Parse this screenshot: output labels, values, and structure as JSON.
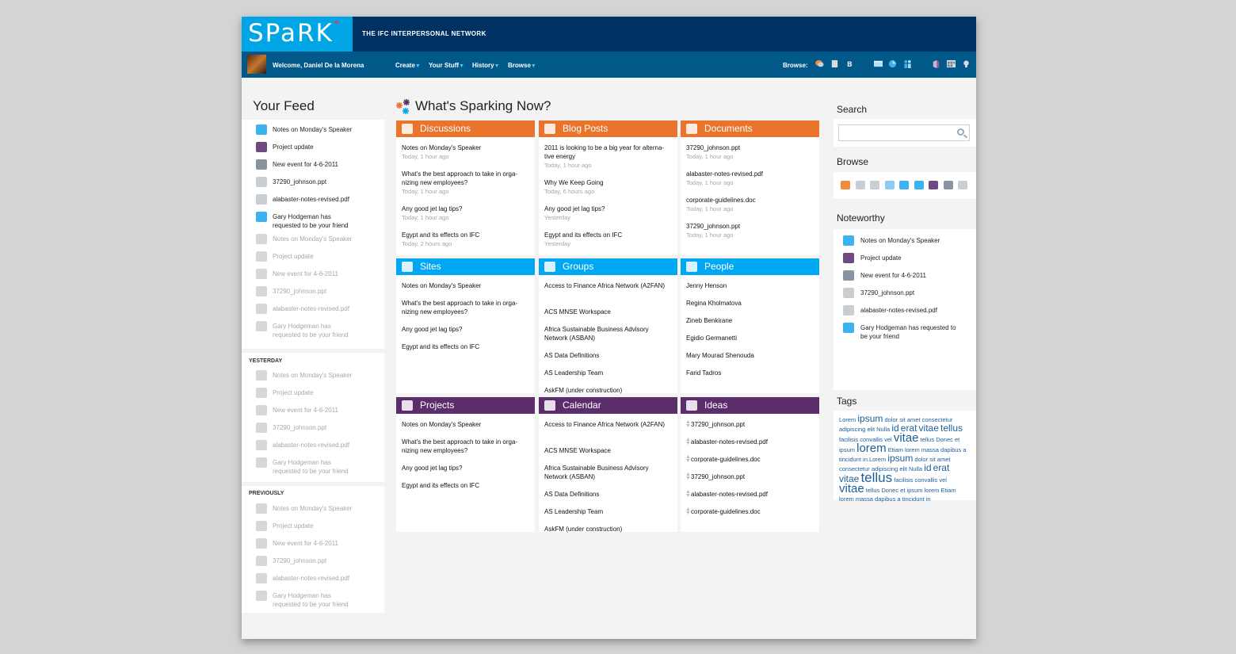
{
  "header": {
    "logo_text": "SPaRK",
    "tagline": "THE IFC INTERPERSONAL NETWORK"
  },
  "nav": {
    "welcome": "Welcome, Daniel De la Morena",
    "menus": [
      "Create",
      "Your Stuff",
      "History",
      "Browse"
    ],
    "browse_label": "Browse:",
    "browse_icons": [
      "discussion-icon",
      "document-icon",
      "blog-icon",
      "sites-icon",
      "groups-icon",
      "people-icon",
      "projects-icon",
      "calendar-icon",
      "ideas-icon"
    ]
  },
  "feed": {
    "title": "Your Feed",
    "today": [
      {
        "icon": "groups-icon",
        "text": "Notes on Monday's Speaker"
      },
      {
        "icon": "projects-icon",
        "text": "Project update"
      },
      {
        "icon": "calendar-icon",
        "text": "New event for 4-6-2011"
      },
      {
        "icon": "document-icon",
        "text": "37290_johnson.ppt"
      },
      {
        "icon": "document-icon",
        "text": "alabaster-notes-revised.pdf"
      },
      {
        "icon": "people-icon",
        "text": "Gary Hodgeman has requested to be your friend"
      },
      {
        "icon": "groups-icon",
        "text": "Notes on Monday's Speaker"
      },
      {
        "icon": "projects-icon",
        "text": "Project update"
      },
      {
        "icon": "calendar-icon",
        "text": "New event for 4-6-2011"
      },
      {
        "icon": "document-icon",
        "text": "37290_johnson.ppt"
      },
      {
        "icon": "document-icon",
        "text": "alabaster-notes-revised.pdf"
      },
      {
        "icon": "people-icon",
        "text": "Gary Hodgeman has requested to be your friend"
      }
    ],
    "yesterday_label": "YESTERDAY",
    "yesterday": [
      {
        "icon": "groups-icon",
        "text": "Notes on Monday's Speaker"
      },
      {
        "icon": "projects-icon",
        "text": "Project update"
      },
      {
        "icon": "calendar-icon",
        "text": "New event for 4-6-2011"
      },
      {
        "icon": "document-icon",
        "text": "37290_johnson.ppt"
      },
      {
        "icon": "document-icon",
        "text": "alabaster-notes-revised.pdf"
      },
      {
        "icon": "people-icon",
        "text": "Gary Hodgeman has requested to be your friend"
      }
    ],
    "previously_label": "PREVIOUSLY",
    "previously": [
      {
        "icon": "groups-icon",
        "text": "Notes on Monday's Speaker"
      },
      {
        "icon": "projects-icon",
        "text": "Project update"
      },
      {
        "icon": "calendar-icon",
        "text": "New event for 4-6-2011"
      },
      {
        "icon": "document-icon",
        "text": "37290_johnson.ppt"
      },
      {
        "icon": "document-icon",
        "text": "alabaster-notes-revised.pdf"
      },
      {
        "icon": "people-icon",
        "text": "Gary Hodgeman has requested to be your friend"
      }
    ]
  },
  "sparking": {
    "title": "What's Sparking Now?",
    "boxes": [
      {
        "title": "Discussions",
        "color": "orange",
        "icon": "discussion-icon",
        "items": [
          {
            "text": "Notes on Monday's Speaker",
            "meta": "Today, 1 hour ago"
          },
          {
            "text": "What's the best approach to take in orga-nizing new employees?",
            "meta": "Today, 1 hour ago"
          },
          {
            "text": "Any good jet lag tips?",
            "meta": "Today, 1 hour ago"
          },
          {
            "text": "Egypt and its effects on IFC",
            "meta": "Today, 2 hours ago"
          }
        ]
      },
      {
        "title": "Blog Posts",
        "color": "orange",
        "icon": "blog-icon",
        "items": [
          {
            "text": "2011 is looking to be a big year for alterna-tive energy",
            "meta": "Today, 1 hour ago"
          },
          {
            "text": "Why We Keep Going",
            "meta": "Today, 6 hours ago"
          },
          {
            "text": "Any good jet lag tips?",
            "meta": "Yesterday"
          },
          {
            "text": "Egypt and its effects on IFC",
            "meta": "Yesterday"
          }
        ]
      },
      {
        "title": "Documents",
        "color": "orange",
        "icon": "document-icon",
        "items": [
          {
            "text": "37290_johnson.ppt",
            "meta": "Today, 1 hour ago"
          },
          {
            "text": "alabaster-notes-revised.pdf",
            "meta": "Today, 1 hour ago"
          },
          {
            "text": "corporate-guidelines.doc",
            "meta": "Today, 1 hour ago"
          },
          {
            "text": "37290_johnson.ppt",
            "meta": "Today, 1 hour ago"
          }
        ]
      },
      {
        "title": "Sites",
        "color": "blue",
        "icon": "sites-icon",
        "items": [
          {
            "text": "Notes on Monday's Speaker"
          },
          {
            "text": "What's the best approach to take in orga-nizing new employees?"
          },
          {
            "text": "Any good jet lag tips?"
          },
          {
            "text": "Egypt and its effects on IFC"
          }
        ]
      },
      {
        "title": "Groups",
        "color": "blue",
        "icon": "groups-icon",
        "items": [
          {
            "text": "Access to Finance Africa Network (A2FAN)"
          },
          {
            "text": "ACS MNSE Workspace"
          },
          {
            "text": "Africa Sustainable Business Advisory Network (ASBAN)"
          },
          {
            "text": "AS Data Definitions"
          },
          {
            "text": "AS Leadership Team"
          },
          {
            "text": "AskFM (under construction)"
          }
        ]
      },
      {
        "title": "People",
        "color": "blue",
        "icon": "people-icon",
        "items": [
          {
            "text": "Jenny Henson"
          },
          {
            "text": "Regina Kholmatova"
          },
          {
            "text": "Zineb Benkirane"
          },
          {
            "text": "Egidio Germanetti"
          },
          {
            "text": "Mary Mourad Shenouda"
          },
          {
            "text": "Farid Tadros"
          }
        ]
      },
      {
        "title": "Projects",
        "color": "purple",
        "icon": "projects-icon",
        "items": [
          {
            "text": "Notes on Monday's Speaker"
          },
          {
            "text": "What's the best approach to take in orga-nizing new employees?"
          },
          {
            "text": "Any good jet lag tips?"
          },
          {
            "text": "Egypt and its effects on IFC"
          }
        ]
      },
      {
        "title": "Calendar",
        "color": "purple",
        "icon": "calendar-icon",
        "items": [
          {
            "text": "Access to Finance Africa Network (A2FAN)"
          },
          {
            "text": "ACS MNSE Workspace"
          },
          {
            "text": "Africa Sustainable Business Advisory Network (ASBAN)"
          },
          {
            "text": "AS Data Definitions"
          },
          {
            "text": "AS Leadership Team"
          },
          {
            "text": "AskFM (under construction)"
          }
        ]
      },
      {
        "title": "Ideas",
        "color": "purple",
        "icon": "ideas-icon",
        "items": [
          {
            "text": "37290_johnson.ppt"
          },
          {
            "text": "alabaster-notes-revised.pdf"
          },
          {
            "text": "corporate-guidelines.doc"
          },
          {
            "text": "37290_johnson.ppt"
          },
          {
            "text": "alabaster-notes-revised.pdf"
          },
          {
            "text": "corporate-guidelines.doc"
          }
        ]
      }
    ]
  },
  "sidebar": {
    "search_title": "Search",
    "search_placeholder": "",
    "browse_title": "Browse",
    "noteworthy_title": "Noteworthy",
    "noteworthy": [
      {
        "icon": "groups-icon",
        "text": "Notes on Monday's Speaker"
      },
      {
        "icon": "projects-icon",
        "text": "Project update"
      },
      {
        "icon": "calendar-icon",
        "text": "New event for 4-6-2011"
      },
      {
        "icon": "document-icon",
        "text": "37290_johnson.ppt"
      },
      {
        "icon": "document-icon",
        "text": "alabaster-notes-revised.pdf"
      },
      {
        "icon": "people-icon",
        "text": "Gary Hodgeman has requested to be your friend"
      }
    ],
    "tags_title": "Tags",
    "tags": [
      {
        "t": "Lorem",
        "s": 0
      },
      {
        "t": "ipsum",
        "s": 1
      },
      {
        "t": "dolor",
        "s": 0
      },
      {
        "t": "sit",
        "s": 0
      },
      {
        "t": "amet",
        "s": 0
      },
      {
        "t": "consectetur",
        "s": 0
      },
      {
        "t": "adipiscing",
        "s": 0
      },
      {
        "t": "elit",
        "s": 0
      },
      {
        "t": "Nulla",
        "s": 0
      },
      {
        "t": "id",
        "s": 1
      },
      {
        "t": "erat",
        "s": 1
      },
      {
        "t": "vitae",
        "s": 1
      },
      {
        "t": "tellus",
        "s": 1
      },
      {
        "t": "facilisis",
        "s": 0
      },
      {
        "t": "convallis",
        "s": 0
      },
      {
        "t": "vel",
        "s": 0
      },
      {
        "t": "vitae",
        "s": 2
      },
      {
        "t": "tellus",
        "s": 0
      },
      {
        "t": "Donec",
        "s": 0
      },
      {
        "t": "et",
        "s": 0
      },
      {
        "t": "ipsum",
        "s": 0
      },
      {
        "t": "lorem",
        "s": 2
      },
      {
        "t": "Etiam",
        "s": 0
      },
      {
        "t": "lorem",
        "s": 0
      },
      {
        "t": "massa",
        "s": 0
      },
      {
        "t": "dapibus",
        "s": 0
      },
      {
        "t": "a",
        "s": 0
      },
      {
        "t": "tincidunt",
        "s": 0
      },
      {
        "t": "in.Lorem",
        "s": 0
      },
      {
        "t": "ipsum",
        "s": 1
      },
      {
        "t": "dolor",
        "s": 0
      },
      {
        "t": "sit",
        "s": 0
      },
      {
        "t": "amet",
        "s": 0
      },
      {
        "t": "consectetur",
        "s": 0
      },
      {
        "t": "adipiscing",
        "s": 0
      },
      {
        "t": "elit",
        "s": 0
      },
      {
        "t": "Nulla",
        "s": 0
      },
      {
        "t": "id",
        "s": 1
      },
      {
        "t": "erat",
        "s": 1
      },
      {
        "t": "vitae",
        "s": 1
      },
      {
        "t": "tellus",
        "s": 3
      },
      {
        "t": "facilisis",
        "s": 0
      },
      {
        "t": "convallis",
        "s": 0
      },
      {
        "t": "vel",
        "s": 0
      },
      {
        "t": "vitae",
        "s": 2
      },
      {
        "t": "tellus",
        "s": 0
      },
      {
        "t": "Donec",
        "s": 0
      },
      {
        "t": "et",
        "s": 0
      },
      {
        "t": "ipsum",
        "s": 0
      },
      {
        "t": "lorem",
        "s": 0
      },
      {
        "t": "Etiam",
        "s": 0
      },
      {
        "t": "lorem",
        "s": 0
      },
      {
        "t": "massa",
        "s": 0
      },
      {
        "t": "dapibus",
        "s": 0
      },
      {
        "t": "a",
        "s": 0
      },
      {
        "t": "tincidunt",
        "s": 0
      },
      {
        "t": "in",
        "s": 0
      }
    ]
  },
  "colors": {
    "orange": "#ea742b",
    "blue": "#00a7f2",
    "purple": "#5c2d6b",
    "topbar": "#003163",
    "navbar": "#01598a",
    "logo_bg": "#00a5e6"
  }
}
